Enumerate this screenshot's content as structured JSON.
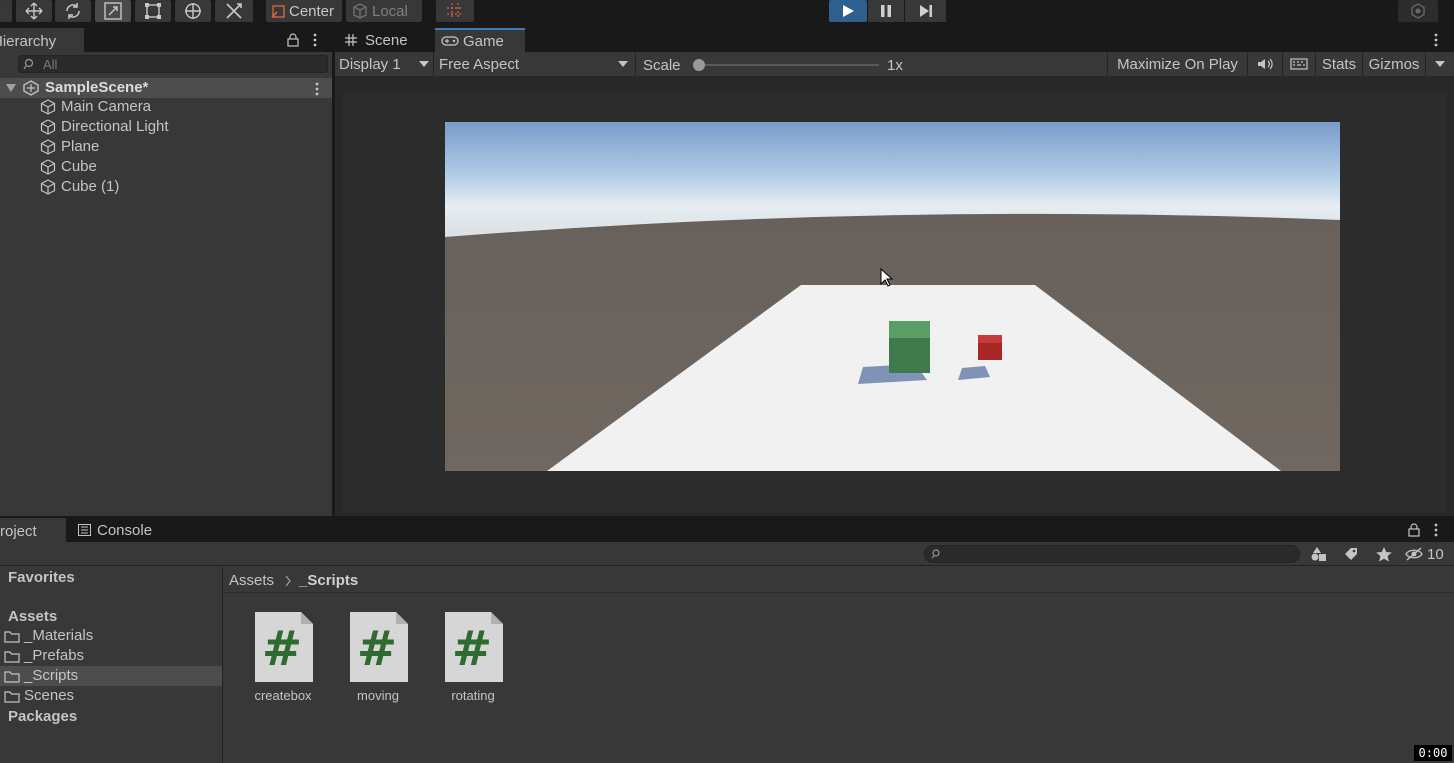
{
  "toolbar": {
    "pivot_label": "Center",
    "space_label": "Local",
    "tools": [
      "view-tool",
      "move-tool",
      "rotate-tool",
      "scale-tool",
      "rect-tool",
      "transform-tool",
      "custom-tool"
    ]
  },
  "hierarchy": {
    "tab_label": "Hierarchy",
    "search_placeholder": "All",
    "scene_name": "SampleScene*",
    "items": [
      {
        "label": "Main Camera"
      },
      {
        "label": "Directional Light"
      },
      {
        "label": "Plane"
      },
      {
        "label": "Cube"
      },
      {
        "label": "Cube (1)"
      }
    ]
  },
  "view_tabs": {
    "scene": "Scene",
    "game": "Game"
  },
  "game_toolbar": {
    "display": "Display 1",
    "aspect": "Free Aspect",
    "scale_label": "Scale",
    "scale_value": "1x",
    "maximize": "Maximize On Play",
    "stats": "Stats",
    "gizmos": "Gizmos"
  },
  "project": {
    "tab_label": "Project",
    "console_label": "Console",
    "hidden_count": "10",
    "favorites": "Favorites",
    "assets_root": "Assets",
    "folders": [
      {
        "label": "_Materials"
      },
      {
        "label": "_Prefabs"
      },
      {
        "label": "_Scripts"
      },
      {
        "label": "Scenes"
      }
    ],
    "packages": "Packages",
    "breadcrumb_root": "Assets",
    "breadcrumb_current": "_Scripts",
    "files": [
      {
        "label": "createbox"
      },
      {
        "label": "moving"
      },
      {
        "label": "rotating"
      }
    ]
  },
  "timer": "0:00",
  "colors": {
    "accent": "#3a79bb",
    "panel": "#383838",
    "script_hash": "#2f6b2f",
    "cube_green": "#4a8f5a",
    "cube_red": "#b02a2a"
  }
}
